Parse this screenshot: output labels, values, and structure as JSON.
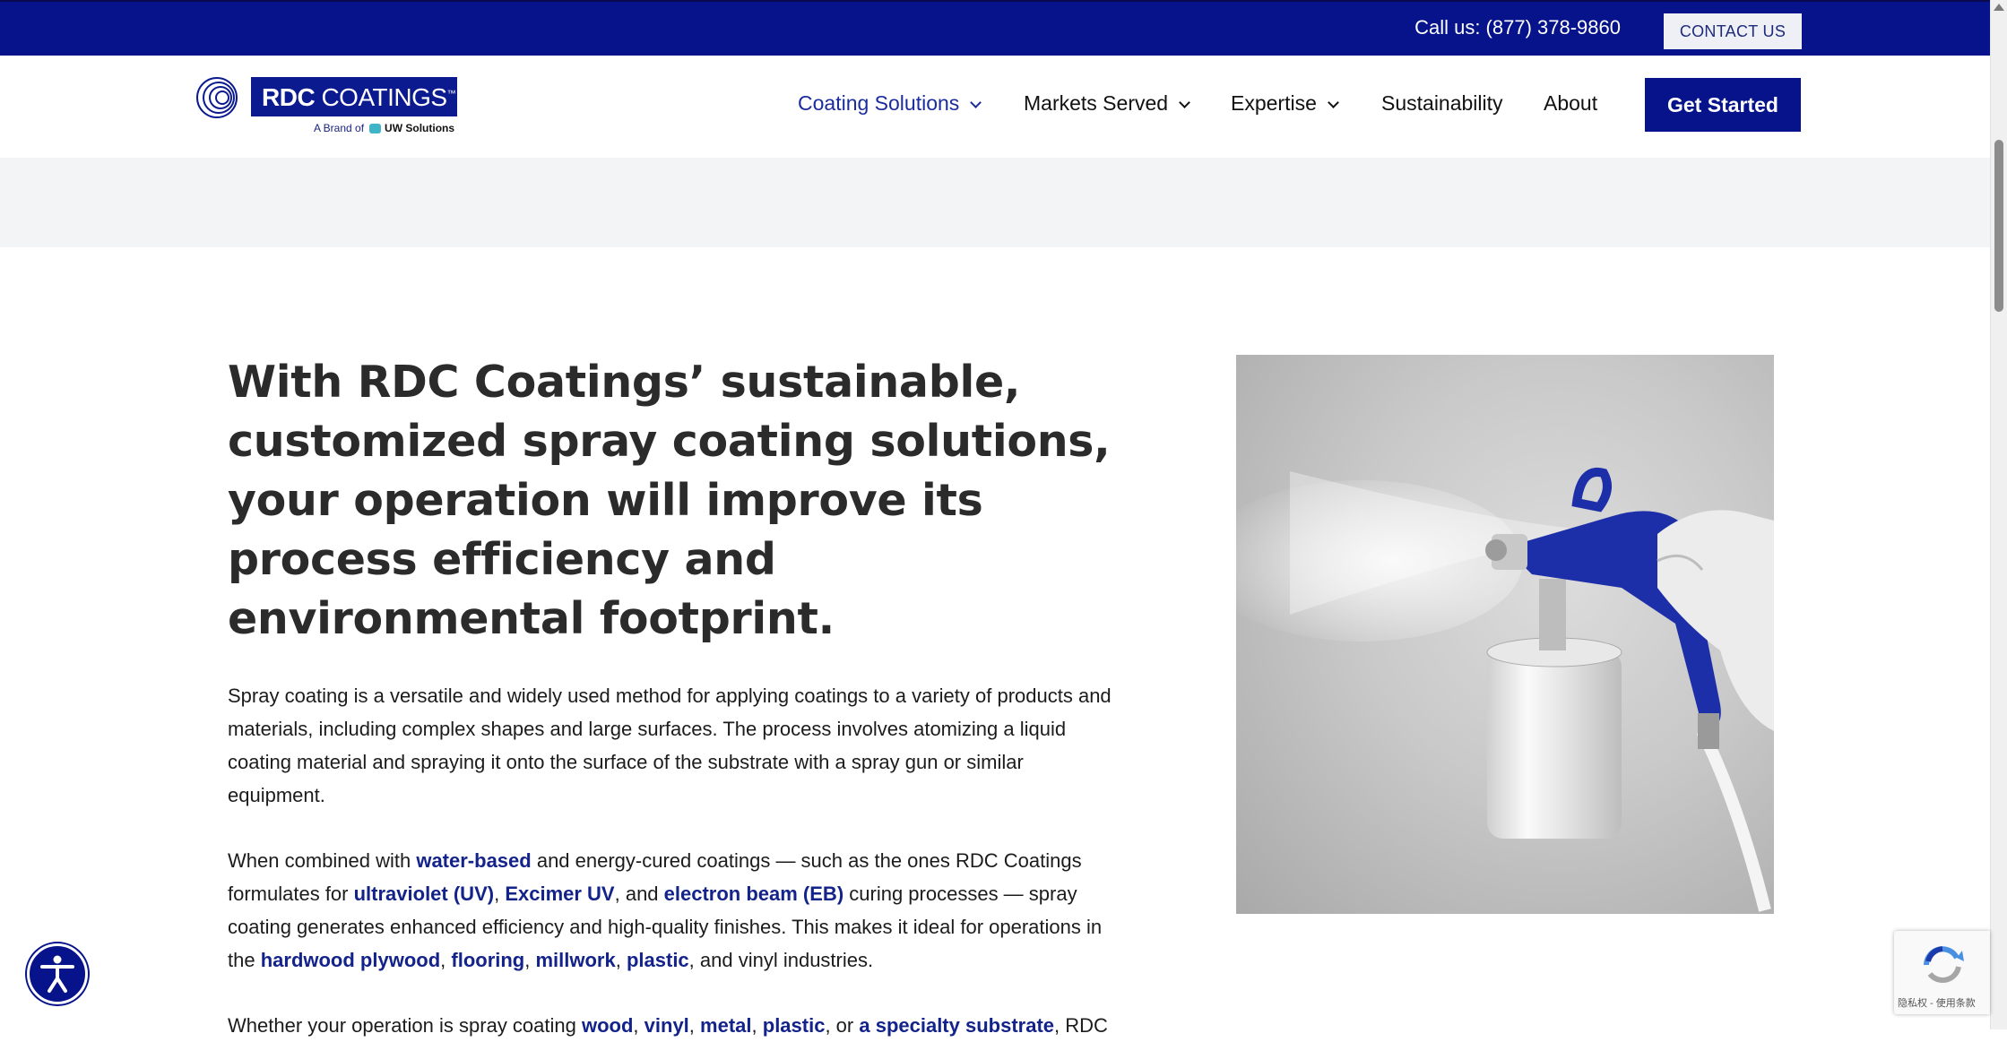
{
  "topbar": {
    "call": "Call us: (877) 378-9860",
    "contact_label": "CONTACT US"
  },
  "logo": {
    "name_bold": "RDC",
    "name_rest": " COATINGS",
    "tm": "™",
    "brand_prefix": "A Brand of",
    "brand_name": "UW Solutions"
  },
  "nav": {
    "items": [
      {
        "label": "Coating Solutions"
      },
      {
        "label": "Markets Served"
      },
      {
        "label": "Expertise"
      },
      {
        "label": "Sustainability"
      },
      {
        "label": "About"
      }
    ],
    "cta": "Get Started"
  },
  "content": {
    "headline": "With RDC Coatings’ sustainable, customized spray coating solutions, your operation will improve its process efficiency and environmental footprint.",
    "p1": "Spray coating is a versatile and widely used method for applying coatings to a variety of products and materials, including complex shapes and large surfaces. The process involves atomizing a liquid coating material and spraying it onto the surface of the substrate with a spray gun or similar equipment.",
    "p2": {
      "t1": "When combined with ",
      "l1": "water-based",
      "t2": " and energy-cured coatings — such as the ones RDC Coatings formulates for ",
      "l2": "ultraviolet (UV)",
      "t3": ", ",
      "l3": "Excimer UV",
      "t4": ", and ",
      "l4": "electron beam (EB)",
      "t5": " curing processes — spray coating generates enhanced efficiency and high-quality finishes. This makes it ideal for operations in the ",
      "l5": "hardwood plywood",
      "t6": ", ",
      "l6": "flooring",
      "t7": ", ",
      "l7": "millwork",
      "t8": ", ",
      "l8": "plastic",
      "t9": ", and vinyl industries."
    },
    "p3": {
      "t1": "Whether your operation is spray coating ",
      "l1": "wood",
      "t2": ", ",
      "l2": "vinyl",
      "t3": ", ",
      "l3": "metal",
      "t4": ", ",
      "l4": "plastic",
      "t5": ", or ",
      "l5": "a specialty substrate",
      "t6": ", RDC"
    }
  },
  "recaptcha": {
    "text": "隐私权 - 使用条款"
  },
  "colors": {
    "brand_navy": "#06138a",
    "link": "#13238a",
    "band": "#f3f4f6"
  }
}
